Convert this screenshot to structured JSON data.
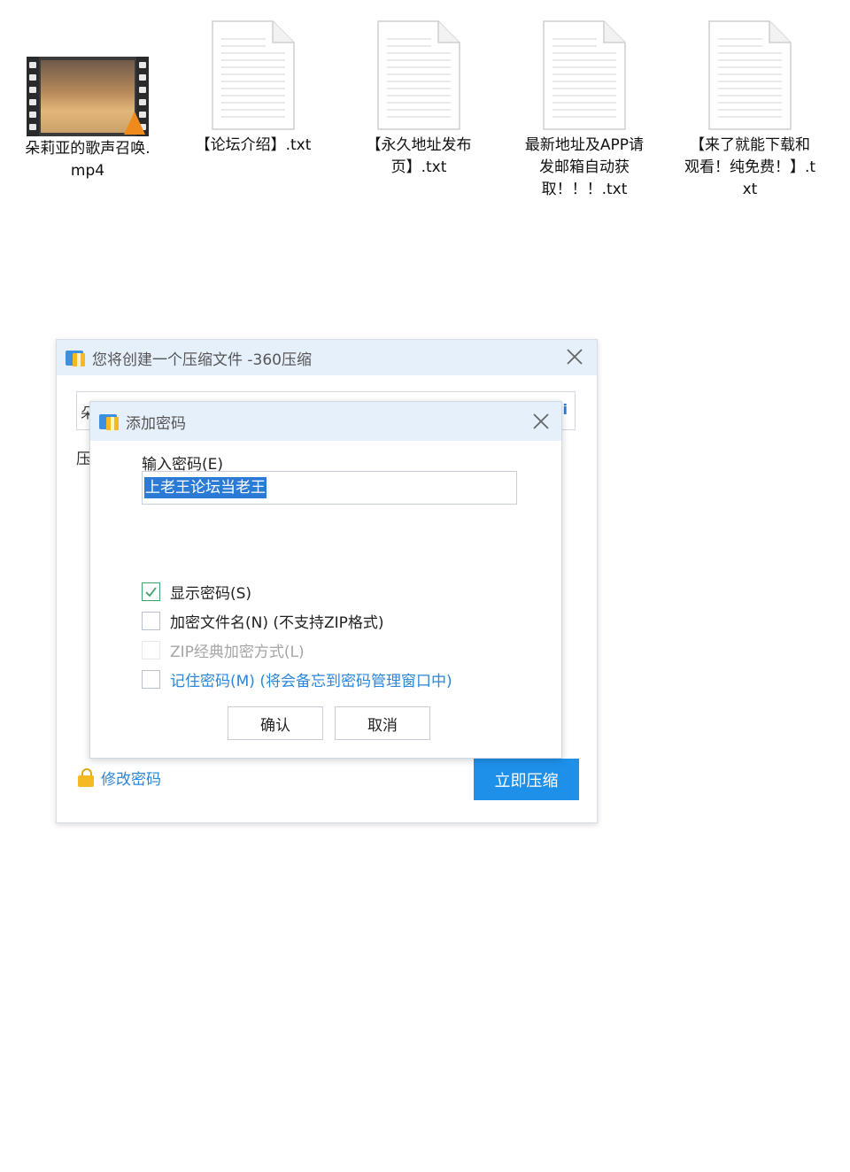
{
  "desktop": {
    "files": [
      {
        "label": "朵莉亚的歌声召唤.mp4",
        "type": "video"
      },
      {
        "label": "【论坛介绍】.txt",
        "type": "text"
      },
      {
        "label": "【永久地址发布页】.txt",
        "type": "text"
      },
      {
        "label": "最新地址及APP请发邮箱自动获取！！！.txt",
        "type": "text"
      },
      {
        "label": "【来了就能下载和观看！纯免费！】.txt",
        "type": "text"
      }
    ]
  },
  "main_dialog": {
    "title": "您将创建一个压缩文件 -360压缩",
    "name_field_peek": "朵",
    "name_field_peek_right": "i",
    "side_label": "压",
    "change_password_link": "修改密码",
    "compress_button": "立即压缩"
  },
  "password_dialog": {
    "title": "添加密码",
    "input_label": "输入密码(E)",
    "password_value": "上老王论坛当老王",
    "options": [
      {
        "label": "显示密码(S)",
        "checked": true,
        "disabled": false,
        "style": "normal"
      },
      {
        "label": "加密文件名(N) (不支持ZIP格式)",
        "checked": false,
        "disabled": false,
        "style": "normal"
      },
      {
        "label": "ZIP经典加密方式(L)",
        "checked": false,
        "disabled": true,
        "style": "disabled"
      },
      {
        "label": "记住密码(M) (将会备忘到密码管理窗口中)",
        "checked": false,
        "disabled": false,
        "style": "link"
      }
    ],
    "confirm_button": "确认",
    "cancel_button": "取消"
  },
  "colors": {
    "titlebar_bg": "#e6f0fb",
    "accent_blue": "#1e90ea",
    "link_blue": "#2a86d9",
    "check_green": "#3aa36a",
    "selection_blue": "#2a7ad6"
  }
}
